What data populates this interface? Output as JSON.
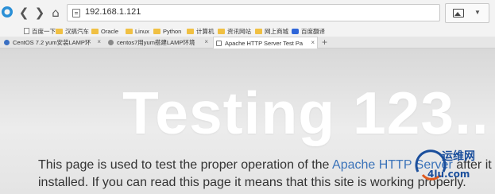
{
  "browser": {
    "url": "192.168.1.121",
    "back_glyph": "❮",
    "forward_glyph": "❯",
    "refresh_glyph": "↻",
    "home_glyph": "⌂",
    "dropdown_glyph": "▼"
  },
  "bookmarks": [
    {
      "label": "百度一下",
      "icon": "doc"
    },
    {
      "label": "汉搞汽车",
      "icon": "folder"
    },
    {
      "label": "Oracle",
      "icon": "folder"
    },
    {
      "label": "Linux",
      "icon": "folder"
    },
    {
      "label": "Python",
      "icon": "folder"
    },
    {
      "label": "计算机",
      "icon": "folder"
    },
    {
      "label": "资讯网站",
      "icon": "folder"
    },
    {
      "label": "网上商城",
      "icon": "folder"
    },
    {
      "label": "百度翻译",
      "icon": "baidu"
    }
  ],
  "tabs": [
    {
      "title": "CentOS 7.2 yum安装LAMP环",
      "active": false
    },
    {
      "title": "centos7用yum搭建LAMP环境",
      "active": false
    },
    {
      "title": "Apache HTTP Server Test Pa",
      "active": true
    }
  ],
  "tab_close_glyph": "×",
  "new_tab_glyph": "+",
  "page": {
    "heading": "Testing 123..",
    "line1_before": "This page is used to test the proper operation of the ",
    "line1_link": "Apache HTTP Server",
    "line1_after": " after it has been",
    "line2": "installed. If you can read this page it means that this site is working properly."
  },
  "watermark": {
    "line1": "运维网",
    "line2": "4lu.com"
  },
  "colors": {
    "link": "#3b73b9",
    "text": "#333333",
    "heading": "#ffffff",
    "folder": "#f0c043"
  }
}
